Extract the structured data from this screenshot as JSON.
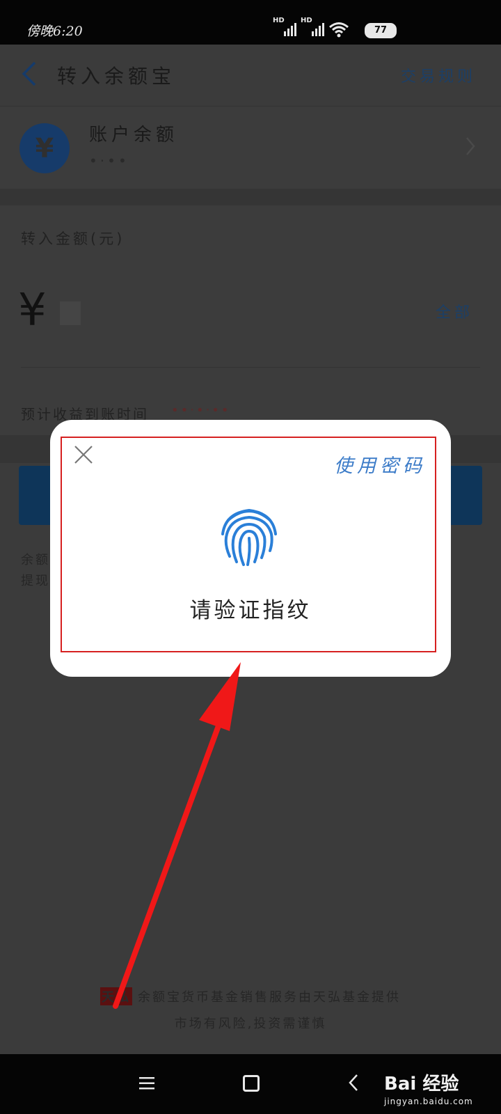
{
  "status_bar": {
    "time": "傍晚6:20",
    "signal_label": "HD",
    "battery": "77"
  },
  "header": {
    "title": "转入余额宝",
    "rules_link": "交易规则"
  },
  "account": {
    "label": "账户余额",
    "currency_symbol": "¥",
    "value_obscured": "•‧••"
  },
  "amount": {
    "label": "转入金额(元)",
    "currency_symbol": "¥",
    "all_link": "全部"
  },
  "estimate": {
    "label": "预计收益到账时间",
    "value_obscured": "••‧•‧••"
  },
  "notice": {
    "line1_start": "余额",
    "line2_start": "提现"
  },
  "footer": {
    "brand": "天弘",
    "line1": "余额宝货币基金销售服务由天弘基金提供",
    "line2": "市场有风险,投资需谨慎"
  },
  "modal": {
    "use_password": "使用密码",
    "verify_text": "请验证指纹"
  },
  "watermark": {
    "brand": "Bai 经验",
    "url": "jingyan.baidu.com"
  },
  "colors": {
    "accent_blue": "#3b7bc8",
    "fingerprint_blue": "#2a7fd8",
    "annotation_red": "#f01818"
  }
}
